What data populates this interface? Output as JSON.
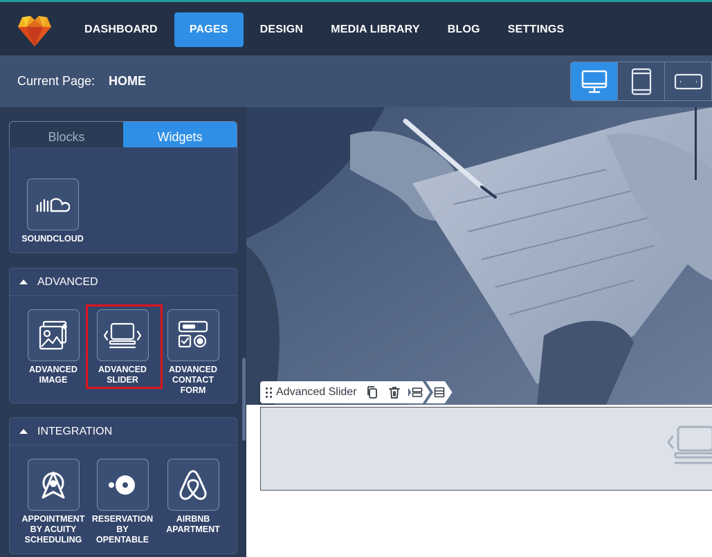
{
  "nav": {
    "items": [
      {
        "label": "DASHBOARD",
        "active": false
      },
      {
        "label": "PAGES",
        "active": true
      },
      {
        "label": "DESIGN",
        "active": false
      },
      {
        "label": "MEDIA LIBRARY",
        "active": false
      },
      {
        "label": "BLOG",
        "active": false
      },
      {
        "label": "SETTINGS",
        "active": false
      }
    ]
  },
  "page_bar": {
    "label": "Current Page:",
    "value": "HOME",
    "devices": [
      "desktop-icon",
      "tablet-icon",
      "tablet-landscape-icon"
    ]
  },
  "sidebar": {
    "tabs": [
      {
        "label": "Blocks",
        "active": false
      },
      {
        "label": "Widgets",
        "active": true
      }
    ],
    "media_widgets": [
      {
        "label": "SOUNDCLOUD",
        "icon": "soundcloud-icon"
      }
    ],
    "advanced": {
      "title": "ADVANCED",
      "widgets": [
        {
          "label": "ADVANCED IMAGE",
          "icon": "advanced-image-icon"
        },
        {
          "label": "ADVANCED SLIDER",
          "icon": "advanced-slider-icon",
          "highlighted": true
        },
        {
          "label": "ADVANCED CONTACT FORM",
          "icon": "contact-form-icon"
        }
      ]
    },
    "integration": {
      "title": "INTEGRATION",
      "widgets": [
        {
          "label": "APPOINTMENT BY ACUITY SCHEDULING",
          "icon": "acuity-icon"
        },
        {
          "label": "RESERVATION BY OPENTABLE",
          "icon": "opentable-icon"
        },
        {
          "label": "AIRBNB APARTMENT",
          "icon": "airbnb-icon"
        }
      ]
    }
  },
  "canvas": {
    "toolbar": {
      "title": "Advanced Slider",
      "actions": [
        "copy-icon",
        "trash-icon"
      ],
      "crumbs": [
        "row-icon",
        "section-icon"
      ]
    }
  },
  "colors": {
    "accent": "#2f8fe6",
    "topbar": "#243045",
    "pagebar": "#3d5172",
    "sidebar": "#2b3a55",
    "highlight": "#e0141e"
  }
}
